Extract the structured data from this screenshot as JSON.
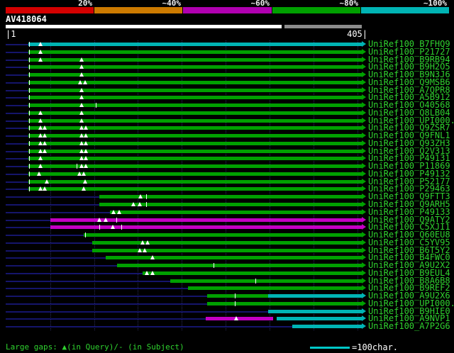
{
  "scale_bar": {
    "segments": [
      {
        "label": "20%",
        "color": "#d40000"
      },
      {
        "label": "~40%",
        "color": "#cc7a00"
      },
      {
        "label": "~60%",
        "color": "#b000b0"
      },
      {
        "label": "~80%",
        "color": "#00a000"
      },
      {
        "label": "~100%",
        "color": "#00b4b4"
      }
    ]
  },
  "query": {
    "name": "AV418064",
    "ruler_start": "|1",
    "ruler_end": "405|",
    "length": 405,
    "bar_segments": [
      {
        "start": 1,
        "end": 314,
        "color": "#ffffff"
      },
      {
        "start": 317,
        "end": 405,
        "color": "#8c8c8c"
      }
    ]
  },
  "footer": {
    "gaps_legend": "Large gaps: ▲(in Query)/- (in Subject)",
    "scale_legend": "=100char.",
    "scale_line_color": "#00c8c8"
  },
  "chart_data": {
    "type": "bar",
    "subtype": "sequence-alignment-overview",
    "title": "AV418064",
    "x_range": [
      1,
      405
    ],
    "grid_marks": [
      50,
      100,
      150,
      200,
      250,
      300,
      350,
      400
    ],
    "identity_colors": {
      "green": "#00a000",
      "magenta": "#c400c4",
      "cyan": "#00b4b4"
    },
    "rows": [
      {
        "label": "UniRef100_B7FHQ9",
        "segments": [
          {
            "start": 25,
            "end": 405,
            "color": "cyan"
          }
        ],
        "query_gaps": [
          39
        ],
        "subject_gaps": [
          26
        ]
      },
      {
        "label": "UniRef100_P21727",
        "segments": [
          {
            "start": 25,
            "end": 405,
            "color": "green"
          }
        ],
        "query_gaps": [
          39
        ],
        "subject_gaps": [
          26
        ]
      },
      {
        "label": "UniRef100_B9RB94",
        "segments": [
          {
            "start": 25,
            "end": 405,
            "color": "green"
          }
        ],
        "query_gaps": [
          39,
          86
        ],
        "subject_gaps": [
          26
        ]
      },
      {
        "label": "UniRef100_B9H2O5",
        "segments": [
          {
            "start": 25,
            "end": 405,
            "color": "green"
          }
        ],
        "query_gaps": [
          86
        ],
        "subject_gaps": [
          26
        ]
      },
      {
        "label": "UniRef100_B9N3J6",
        "segments": [
          {
            "start": 25,
            "end": 405,
            "color": "green"
          }
        ],
        "query_gaps": [
          86
        ],
        "subject_gaps": [
          26
        ]
      },
      {
        "label": "UniRef100_Q9MSB6",
        "segments": [
          {
            "start": 25,
            "end": 405,
            "color": "green"
          }
        ],
        "query_gaps": [
          84,
          90
        ],
        "subject_gaps": [
          26
        ]
      },
      {
        "label": "UniRef100_A7QPR8",
        "segments": [
          {
            "start": 25,
            "end": 405,
            "color": "green"
          }
        ],
        "query_gaps": [
          86
        ],
        "subject_gaps": [
          26
        ]
      },
      {
        "label": "UniRef100_A5B912",
        "segments": [
          {
            "start": 25,
            "end": 405,
            "color": "green"
          }
        ],
        "query_gaps": [
          86
        ],
        "subject_gaps": [
          26
        ]
      },
      {
        "label": "UniRef100_O40568",
        "segments": [
          {
            "start": 25,
            "end": 405,
            "color": "green"
          }
        ],
        "query_gaps": [
          86
        ],
        "subject_gaps": [
          26,
          102
        ]
      },
      {
        "label": "UniRef100_Q8LB04",
        "segments": [
          {
            "start": 25,
            "end": 405,
            "color": "green"
          }
        ],
        "query_gaps": [
          39,
          86
        ],
        "subject_gaps": [
          26
        ]
      },
      {
        "label": "UniRef100_UPI000..",
        "segments": [
          {
            "start": 25,
            "end": 405,
            "color": "green"
          }
        ],
        "query_gaps": [
          39,
          86
        ],
        "subject_gaps": [
          26
        ]
      },
      {
        "label": "UniRef100_Q9ZSR7",
        "segments": [
          {
            "start": 25,
            "end": 405,
            "color": "green"
          }
        ],
        "query_gaps": [
          39,
          44,
          86,
          91
        ],
        "subject_gaps": [
          26
        ]
      },
      {
        "label": "UniRef100_Q9FNL1",
        "segments": [
          {
            "start": 25,
            "end": 405,
            "color": "green"
          }
        ],
        "query_gaps": [
          39,
          44,
          86,
          91
        ],
        "subject_gaps": [
          26
        ]
      },
      {
        "label": "UniRef100_Q93ZH3",
        "segments": [
          {
            "start": 25,
            "end": 405,
            "color": "green"
          }
        ],
        "query_gaps": [
          39,
          44,
          86,
          91
        ],
        "subject_gaps": [
          26
        ]
      },
      {
        "label": "UniRef100_Q2V313",
        "segments": [
          {
            "start": 25,
            "end": 405,
            "color": "green"
          }
        ],
        "query_gaps": [
          39,
          44,
          86,
          91
        ],
        "subject_gaps": [
          26
        ]
      },
      {
        "label": "UniRef100_P49131",
        "segments": [
          {
            "start": 25,
            "end": 405,
            "color": "green"
          }
        ],
        "query_gaps": [
          39,
          86,
          91
        ],
        "subject_gaps": [
          26
        ]
      },
      {
        "label": "UniRef100_P11869",
        "segments": [
          {
            "start": 25,
            "end": 405,
            "color": "green"
          }
        ],
        "query_gaps": [
          39,
          86,
          91
        ],
        "subject_gaps": [
          26,
          80
        ]
      },
      {
        "label": "UniRef100_P49132",
        "segments": [
          {
            "start": 25,
            "end": 405,
            "color": "green"
          }
        ],
        "query_gaps": [
          37,
          83,
          88
        ],
        "subject_gaps": [
          26
        ]
      },
      {
        "label": "UniRef100_P52177",
        "segments": [
          {
            "start": 25,
            "end": 405,
            "color": "green"
          }
        ],
        "query_gaps": [
          46,
          90
        ],
        "subject_gaps": [
          26
        ]
      },
      {
        "label": "UniRef100_P29463",
        "segments": [
          {
            "start": 25,
            "end": 405,
            "color": "green"
          }
        ],
        "query_gaps": [
          39,
          44,
          88
        ],
        "subject_gaps": [
          26
        ]
      },
      {
        "label": "UniRef100_Q9FTT3",
        "segments": [
          {
            "start": 106,
            "end": 405,
            "color": "green"
          }
        ],
        "query_gaps": [
          153
        ],
        "subject_gaps": [
          159
        ]
      },
      {
        "label": "UniRef100_Q9ARH5",
        "segments": [
          {
            "start": 106,
            "end": 405,
            "color": "green"
          }
        ],
        "query_gaps": [
          145,
          152
        ],
        "subject_gaps": [
          159
        ]
      },
      {
        "label": "UniRef100_P49133",
        "segments": [
          {
            "start": 118,
            "end": 405,
            "color": "green"
          }
        ],
        "query_gaps": [
          122,
          129
        ],
        "subject_gaps": []
      },
      {
        "label": "UniRef100_Q9ATY2",
        "segments": [
          {
            "start": 50,
            "end": 405,
            "color": "magenta"
          }
        ],
        "query_gaps": [
          106,
          113
        ],
        "subject_gaps": [
          125
        ]
      },
      {
        "label": "UniRef100_C5XJI1",
        "segments": [
          {
            "start": 50,
            "end": 405,
            "color": "magenta"
          }
        ],
        "query_gaps": [
          121
        ],
        "subject_gaps": [
          106,
          131
        ]
      },
      {
        "label": "UniRef100_Q60EU8",
        "segments": [
          {
            "start": 88,
            "end": 405,
            "color": "green"
          }
        ],
        "query_gaps": [],
        "subject_gaps": [
          90
        ]
      },
      {
        "label": "UniRef100_C5YV95",
        "segments": [
          {
            "start": 98,
            "end": 405,
            "color": "green"
          }
        ],
        "query_gaps": [
          155,
          161
        ],
        "subject_gaps": []
      },
      {
        "label": "UniRef100_B6T5Y2",
        "segments": [
          {
            "start": 98,
            "end": 405,
            "color": "green"
          }
        ],
        "query_gaps": [
          152,
          158
        ],
        "subject_gaps": []
      },
      {
        "label": "UniRef100_B4FWC0",
        "segments": [
          {
            "start": 113,
            "end": 405,
            "color": "green"
          }
        ],
        "query_gaps": [
          167
        ],
        "subject_gaps": []
      },
      {
        "label": "UniRef100_A9U2X2",
        "segments": [
          {
            "start": 126,
            "end": 405,
            "color": "green"
          }
        ],
        "query_gaps": [],
        "subject_gaps": [
          236
        ]
      },
      {
        "label": "UniRef100_B9EUL4",
        "segments": [
          {
            "start": 155,
            "end": 405,
            "color": "green"
          }
        ],
        "query_gaps": [
          160,
          167
        ],
        "subject_gaps": []
      },
      {
        "label": "UniRef100_B8A6B8",
        "segments": [
          {
            "start": 187,
            "end": 405,
            "color": "green"
          }
        ],
        "query_gaps": [],
        "subject_gaps": [
          284
        ]
      },
      {
        "label": "UniRef100_B9REF2",
        "segments": [
          {
            "start": 207,
            "end": 405,
            "color": "green"
          }
        ],
        "query_gaps": [],
        "subject_gaps": []
      },
      {
        "label": "UniRef100_A9U2X6",
        "segments": [
          {
            "start": 229,
            "end": 298,
            "color": "green"
          },
          {
            "start": 298,
            "end": 405,
            "color": "cyan"
          }
        ],
        "query_gaps": [],
        "subject_gaps": [
          260
        ]
      },
      {
        "label": "UniRef100_UPI000..",
        "segments": [
          {
            "start": 229,
            "end": 405,
            "color": "green"
          }
        ],
        "query_gaps": [],
        "subject_gaps": [
          260
        ]
      },
      {
        "label": "UniRef100_B9HIE0",
        "segments": [
          {
            "start": 298,
            "end": 405,
            "color": "cyan"
          }
        ],
        "query_gaps": [],
        "subject_gaps": []
      },
      {
        "label": "UniRef100_A9NVP1",
        "segments": [
          {
            "start": 227,
            "end": 304,
            "color": "magenta"
          },
          {
            "start": 308,
            "end": 405,
            "color": "cyan"
          }
        ],
        "query_gaps": [
          262
        ],
        "subject_gaps": []
      },
      {
        "label": "UniRef100_A7P2G6",
        "segments": [
          {
            "start": 326,
            "end": 405,
            "color": "cyan"
          }
        ],
        "query_gaps": [],
        "subject_gaps": []
      }
    ]
  }
}
